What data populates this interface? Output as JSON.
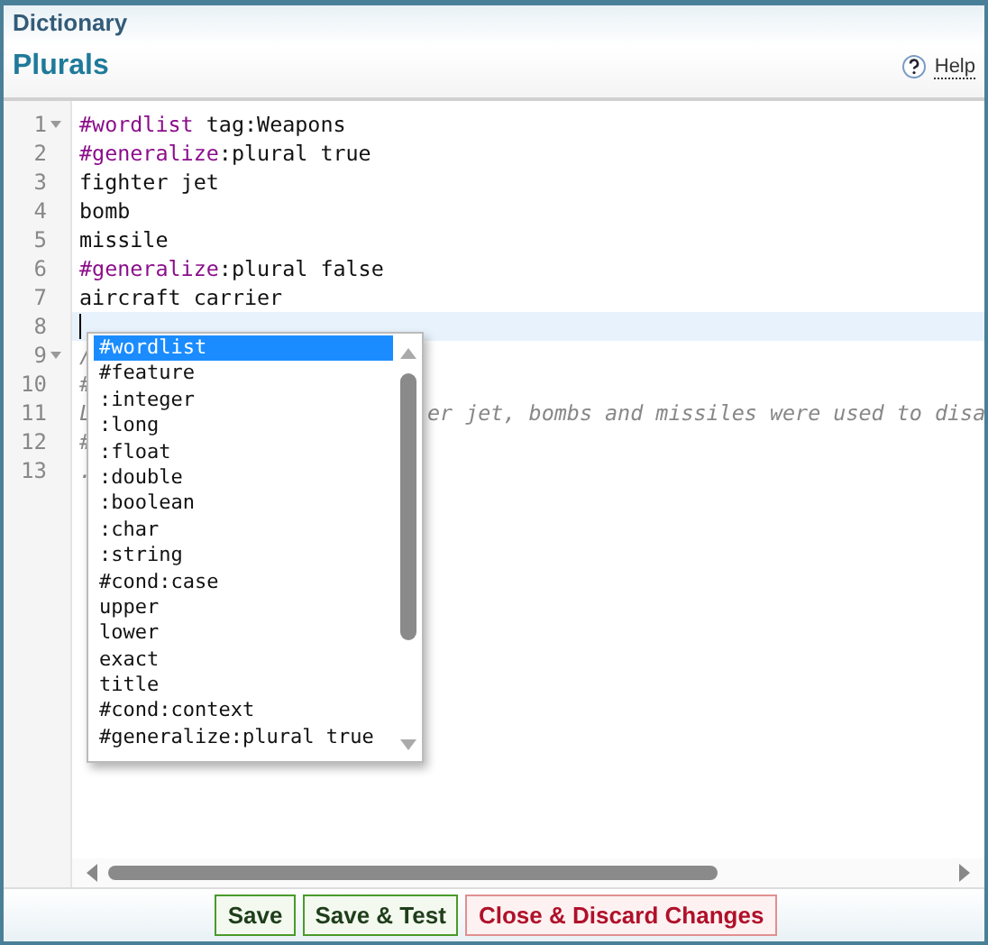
{
  "header": {
    "section": "Dictionary",
    "title": "Plurals",
    "help": "Help"
  },
  "editor": {
    "lines": [
      {
        "number": "1",
        "foldable": true,
        "tokens": [
          {
            "kind": "directive",
            "text": "#wordlist"
          },
          {
            "kind": "plain",
            "text": " tag:Weapons"
          }
        ]
      },
      {
        "number": "2",
        "foldable": false,
        "tokens": [
          {
            "kind": "directive",
            "text": "#generalize"
          },
          {
            "kind": "plain",
            "text": ":plural true"
          }
        ]
      },
      {
        "number": "3",
        "foldable": false,
        "tokens": [
          {
            "kind": "plain",
            "text": "fighter jet"
          }
        ]
      },
      {
        "number": "4",
        "foldable": false,
        "tokens": [
          {
            "kind": "plain",
            "text": "bomb"
          }
        ]
      },
      {
        "number": "5",
        "foldable": false,
        "tokens": [
          {
            "kind": "plain",
            "text": "missile"
          }
        ]
      },
      {
        "number": "6",
        "foldable": false,
        "tokens": [
          {
            "kind": "directive",
            "text": "#generalize"
          },
          {
            "kind": "plain",
            "text": ":plural false"
          }
        ]
      },
      {
        "number": "7",
        "foldable": false,
        "tokens": [
          {
            "kind": "plain",
            "text": "aircraft carrier"
          }
        ]
      },
      {
        "number": "8",
        "foldable": false,
        "current": true
      },
      {
        "number": "9",
        "foldable": true,
        "tokens": [
          {
            "kind": "comment",
            "text": "/"
          }
        ]
      },
      {
        "number": "10",
        "foldable": false,
        "tokens": [
          {
            "kind": "comment",
            "text": "#"
          }
        ]
      },
      {
        "number": "11",
        "foldable": false,
        "tokens": [
          {
            "kind": "comment",
            "text": "L"
          }
        ],
        "tail": "er jet, bombs and missiles were used to disa"
      },
      {
        "number": "12",
        "foldable": false,
        "tokens": [
          {
            "kind": "comment",
            "text": "#"
          }
        ]
      },
      {
        "number": "13",
        "foldable": false,
        "tokens": [
          {
            "kind": "comment",
            "text": "."
          }
        ]
      }
    ]
  },
  "autocomplete": [
    {
      "text": "#wordlist",
      "selected": true
    },
    {
      "text": "#feature",
      "selected": false
    },
    {
      "text": ":integer",
      "selected": false
    },
    {
      "text": ":long",
      "selected": false
    },
    {
      "text": ":float",
      "selected": false
    },
    {
      "text": ":double",
      "selected": false
    },
    {
      "text": ":boolean",
      "selected": false
    },
    {
      "text": ":char",
      "selected": false
    },
    {
      "text": ":string",
      "selected": false
    },
    {
      "text": "#cond:case",
      "selected": false
    },
    {
      "text": "upper",
      "selected": false
    },
    {
      "text": "lower",
      "selected": false
    },
    {
      "text": "exact",
      "selected": false
    },
    {
      "text": "title",
      "selected": false
    },
    {
      "text": "#cond:context",
      "selected": false
    },
    {
      "text": "#generalize:plural true",
      "selected": false
    }
  ],
  "buttons": [
    {
      "label": "Save",
      "kind": "ok"
    },
    {
      "label": "Save & Test",
      "kind": "ok"
    },
    {
      "label": "Close & Discard Changes",
      "kind": "danger"
    }
  ]
}
